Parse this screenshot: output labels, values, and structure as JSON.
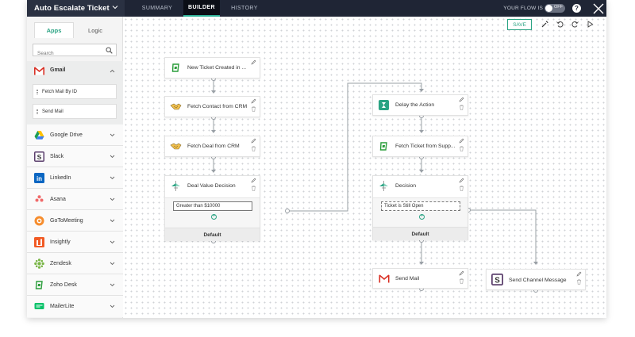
{
  "header": {
    "flow_title": "Auto Escalate Ticket",
    "tabs": [
      {
        "label": "SUMMARY"
      },
      {
        "label": "BUILDER"
      },
      {
        "label": "HISTORY"
      }
    ],
    "flow_status_label": "YOUR FLOW IS",
    "toggle_state": "OFF",
    "help_glyph": "?"
  },
  "sidebar": {
    "tabs": [
      {
        "label": "Apps"
      },
      {
        "label": "Logic"
      }
    ],
    "search_placeholder": "Search",
    "expanded_app": {
      "name": "Gmail",
      "actions": [
        "Fetch Mail By ID",
        "Send Mail"
      ]
    },
    "apps": [
      {
        "name": "Google Drive"
      },
      {
        "name": "Slack"
      },
      {
        "name": "LinkedIn"
      },
      {
        "name": "Asana"
      },
      {
        "name": "GoToMeeting"
      },
      {
        "name": "Insightly"
      },
      {
        "name": "Zendesk"
      },
      {
        "name": "Zoho Desk"
      },
      {
        "name": "MailerLite"
      }
    ]
  },
  "canvas": {
    "save_label": "SAVE",
    "nodes": {
      "trigger": "New Ticket Created in ...",
      "fetch_contact": "Fetch Contact from CRM",
      "fetch_deal": "Fetch Deal from CRM",
      "deal_decision": "Deal Value Decision",
      "deal_condition": "Greater than $10000",
      "deal_default": "Default",
      "delay": "Delay the Action",
      "fetch_ticket": "Fetch Ticket from Supp...",
      "decision2": "Decision",
      "decision2_condition": "Ticket is Still Open",
      "decision2_default": "Default",
      "send_mail": "Send Mail",
      "send_channel": "Send Channel Message"
    }
  },
  "colors": {
    "accent": "#2aa383",
    "topbar": "#1f2535"
  }
}
